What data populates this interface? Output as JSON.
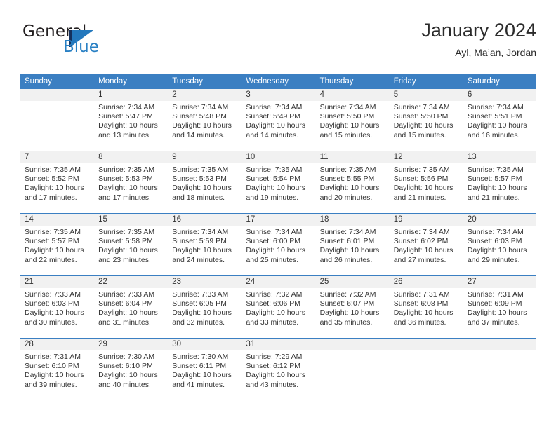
{
  "logo": {
    "word_one": "General",
    "word_two": "Blue",
    "triangle_color": "#2378bd",
    "bar_color": "#15305c"
  },
  "header": {
    "title": "January 2024",
    "subtitle": "Ayl, Ma’an, Jordan"
  },
  "theme": {
    "header_blue": "#3b7fc2",
    "daynum_gray": "#f1f1f1",
    "text": "#333333"
  },
  "calendar": {
    "weekday_headers": [
      "Sunday",
      "Monday",
      "Tuesday",
      "Wednesday",
      "Thursday",
      "Friday",
      "Saturday"
    ],
    "labels": {
      "sunrise": "Sunrise:",
      "sunset": "Sunset:",
      "daylight": "Daylight:"
    },
    "weeks": [
      [
        {
          "day": "",
          "sunrise": "",
          "sunset": "",
          "daylight_1": "",
          "daylight_2": ""
        },
        {
          "day": "1",
          "sunrise": "Sunrise: 7:34 AM",
          "sunset": "Sunset: 5:47 PM",
          "daylight_1": "Daylight: 10 hours",
          "daylight_2": "and 13 minutes."
        },
        {
          "day": "2",
          "sunrise": "Sunrise: 7:34 AM",
          "sunset": "Sunset: 5:48 PM",
          "daylight_1": "Daylight: 10 hours",
          "daylight_2": "and 14 minutes."
        },
        {
          "day": "3",
          "sunrise": "Sunrise: 7:34 AM",
          "sunset": "Sunset: 5:49 PM",
          "daylight_1": "Daylight: 10 hours",
          "daylight_2": "and 14 minutes."
        },
        {
          "day": "4",
          "sunrise": "Sunrise: 7:34 AM",
          "sunset": "Sunset: 5:50 PM",
          "daylight_1": "Daylight: 10 hours",
          "daylight_2": "and 15 minutes."
        },
        {
          "day": "5",
          "sunrise": "Sunrise: 7:34 AM",
          "sunset": "Sunset: 5:50 PM",
          "daylight_1": "Daylight: 10 hours",
          "daylight_2": "and 15 minutes."
        },
        {
          "day": "6",
          "sunrise": "Sunrise: 7:34 AM",
          "sunset": "Sunset: 5:51 PM",
          "daylight_1": "Daylight: 10 hours",
          "daylight_2": "and 16 minutes."
        }
      ],
      [
        {
          "day": "7",
          "sunrise": "Sunrise: 7:35 AM",
          "sunset": "Sunset: 5:52 PM",
          "daylight_1": "Daylight: 10 hours",
          "daylight_2": "and 17 minutes."
        },
        {
          "day": "8",
          "sunrise": "Sunrise: 7:35 AM",
          "sunset": "Sunset: 5:53 PM",
          "daylight_1": "Daylight: 10 hours",
          "daylight_2": "and 17 minutes."
        },
        {
          "day": "9",
          "sunrise": "Sunrise: 7:35 AM",
          "sunset": "Sunset: 5:53 PM",
          "daylight_1": "Daylight: 10 hours",
          "daylight_2": "and 18 minutes."
        },
        {
          "day": "10",
          "sunrise": "Sunrise: 7:35 AM",
          "sunset": "Sunset: 5:54 PM",
          "daylight_1": "Daylight: 10 hours",
          "daylight_2": "and 19 minutes."
        },
        {
          "day": "11",
          "sunrise": "Sunrise: 7:35 AM",
          "sunset": "Sunset: 5:55 PM",
          "daylight_1": "Daylight: 10 hours",
          "daylight_2": "and 20 minutes."
        },
        {
          "day": "12",
          "sunrise": "Sunrise: 7:35 AM",
          "sunset": "Sunset: 5:56 PM",
          "daylight_1": "Daylight: 10 hours",
          "daylight_2": "and 21 minutes."
        },
        {
          "day": "13",
          "sunrise": "Sunrise: 7:35 AM",
          "sunset": "Sunset: 5:57 PM",
          "daylight_1": "Daylight: 10 hours",
          "daylight_2": "and 21 minutes."
        }
      ],
      [
        {
          "day": "14",
          "sunrise": "Sunrise: 7:35 AM",
          "sunset": "Sunset: 5:57 PM",
          "daylight_1": "Daylight: 10 hours",
          "daylight_2": "and 22 minutes."
        },
        {
          "day": "15",
          "sunrise": "Sunrise: 7:35 AM",
          "sunset": "Sunset: 5:58 PM",
          "daylight_1": "Daylight: 10 hours",
          "daylight_2": "and 23 minutes."
        },
        {
          "day": "16",
          "sunrise": "Sunrise: 7:34 AM",
          "sunset": "Sunset: 5:59 PM",
          "daylight_1": "Daylight: 10 hours",
          "daylight_2": "and 24 minutes."
        },
        {
          "day": "17",
          "sunrise": "Sunrise: 7:34 AM",
          "sunset": "Sunset: 6:00 PM",
          "daylight_1": "Daylight: 10 hours",
          "daylight_2": "and 25 minutes."
        },
        {
          "day": "18",
          "sunrise": "Sunrise: 7:34 AM",
          "sunset": "Sunset: 6:01 PM",
          "daylight_1": "Daylight: 10 hours",
          "daylight_2": "and 26 minutes."
        },
        {
          "day": "19",
          "sunrise": "Sunrise: 7:34 AM",
          "sunset": "Sunset: 6:02 PM",
          "daylight_1": "Daylight: 10 hours",
          "daylight_2": "and 27 minutes."
        },
        {
          "day": "20",
          "sunrise": "Sunrise: 7:34 AM",
          "sunset": "Sunset: 6:03 PM",
          "daylight_1": "Daylight: 10 hours",
          "daylight_2": "and 29 minutes."
        }
      ],
      [
        {
          "day": "21",
          "sunrise": "Sunrise: 7:33 AM",
          "sunset": "Sunset: 6:03 PM",
          "daylight_1": "Daylight: 10 hours",
          "daylight_2": "and 30 minutes."
        },
        {
          "day": "22",
          "sunrise": "Sunrise: 7:33 AM",
          "sunset": "Sunset: 6:04 PM",
          "daylight_1": "Daylight: 10 hours",
          "daylight_2": "and 31 minutes."
        },
        {
          "day": "23",
          "sunrise": "Sunrise: 7:33 AM",
          "sunset": "Sunset: 6:05 PM",
          "daylight_1": "Daylight: 10 hours",
          "daylight_2": "and 32 minutes."
        },
        {
          "day": "24",
          "sunrise": "Sunrise: 7:32 AM",
          "sunset": "Sunset: 6:06 PM",
          "daylight_1": "Daylight: 10 hours",
          "daylight_2": "and 33 minutes."
        },
        {
          "day": "25",
          "sunrise": "Sunrise: 7:32 AM",
          "sunset": "Sunset: 6:07 PM",
          "daylight_1": "Daylight: 10 hours",
          "daylight_2": "and 35 minutes."
        },
        {
          "day": "26",
          "sunrise": "Sunrise: 7:31 AM",
          "sunset": "Sunset: 6:08 PM",
          "daylight_1": "Daylight: 10 hours",
          "daylight_2": "and 36 minutes."
        },
        {
          "day": "27",
          "sunrise": "Sunrise: 7:31 AM",
          "sunset": "Sunset: 6:09 PM",
          "daylight_1": "Daylight: 10 hours",
          "daylight_2": "and 37 minutes."
        }
      ],
      [
        {
          "day": "28",
          "sunrise": "Sunrise: 7:31 AM",
          "sunset": "Sunset: 6:10 PM",
          "daylight_1": "Daylight: 10 hours",
          "daylight_2": "and 39 minutes."
        },
        {
          "day": "29",
          "sunrise": "Sunrise: 7:30 AM",
          "sunset": "Sunset: 6:10 PM",
          "daylight_1": "Daylight: 10 hours",
          "daylight_2": "and 40 minutes."
        },
        {
          "day": "30",
          "sunrise": "Sunrise: 7:30 AM",
          "sunset": "Sunset: 6:11 PM",
          "daylight_1": "Daylight: 10 hours",
          "daylight_2": "and 41 minutes."
        },
        {
          "day": "31",
          "sunrise": "Sunrise: 7:29 AM",
          "sunset": "Sunset: 6:12 PM",
          "daylight_1": "Daylight: 10 hours",
          "daylight_2": "and 43 minutes."
        },
        {
          "day": "",
          "sunrise": "",
          "sunset": "",
          "daylight_1": "",
          "daylight_2": ""
        },
        {
          "day": "",
          "sunrise": "",
          "sunset": "",
          "daylight_1": "",
          "daylight_2": ""
        },
        {
          "day": "",
          "sunrise": "",
          "sunset": "",
          "daylight_1": "",
          "daylight_2": ""
        }
      ]
    ]
  }
}
